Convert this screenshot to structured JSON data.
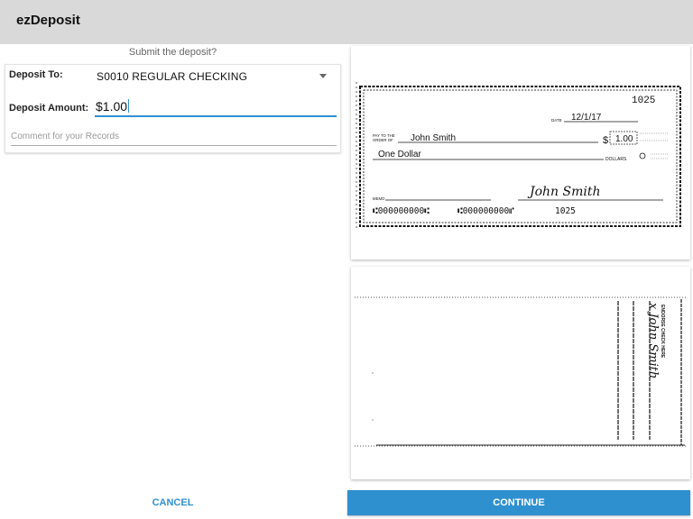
{
  "app": {
    "title": "ezDeposit"
  },
  "prompt": "Submit the deposit?",
  "form": {
    "deposit_to_label": "Deposit To:",
    "deposit_to_value": "S0010 REGULAR CHECKING",
    "deposit_amount_label": "Deposit Amount:",
    "deposit_amount_value": "$1.00",
    "comment_placeholder": "Comment for your Records"
  },
  "check_front": {
    "check_number": "1025",
    "date_label": "DATE",
    "date": "12/1/17",
    "pay_to_label_1": "PAY TO THE",
    "pay_to_label_2": "ORDER OF",
    "payee": "John Smith",
    "dollar_sign": "$",
    "amount": "1.00",
    "written_amount": "One Dollar",
    "dollars_label": "DOLLARS",
    "memo_label": "MEMO",
    "signature": "John Smith",
    "micr_routing": "⑆000000000⑆",
    "micr_account": "⑆000000000⑈",
    "micr_number": "1025"
  },
  "check_back": {
    "endorse_label": "ENDORSE CHECK HERE",
    "endorsement": "x John Smith"
  },
  "buttons": {
    "cancel": "CANCEL",
    "continue": "CONTINUE"
  },
  "colors": {
    "accent": "#2f90d0",
    "appbar": "#d9d9d9"
  }
}
